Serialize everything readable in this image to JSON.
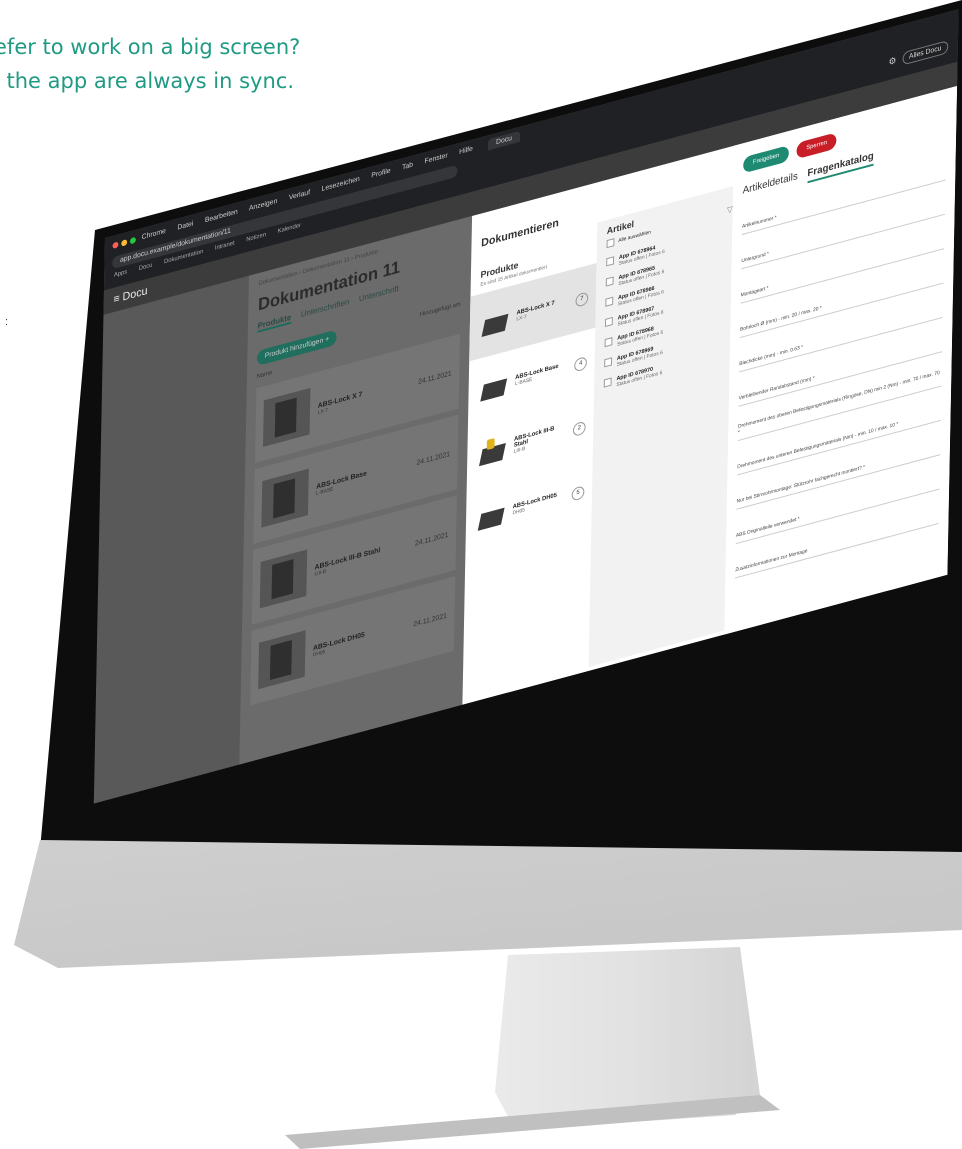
{
  "headline": {
    "line1": "efer to work on a big screen?",
    "line2": "l the app are always in sync."
  },
  "browser": {
    "menu": [
      "Chrome",
      "Datei",
      "Bearbeiten",
      "Anzeigen",
      "Verlauf",
      "Lesezeichen",
      "Profile",
      "Tab",
      "Fenster",
      "Hilfe"
    ],
    "tab_label": "Docu",
    "address": "app.docu.example/dokumentation/11",
    "bookmarks": [
      "Apps",
      "Docu",
      "Dokumentation",
      "Intranet",
      "Notizen",
      "Kalender"
    ],
    "alle_label": "Alles Docu"
  },
  "app": {
    "brand": "≡ Docu"
  },
  "left_page": {
    "breadcrumb": "Dokumentation  ›  Dokumentation 11  ›  Produkte",
    "title": "Dokumentation 11",
    "tabs": [
      "Produkte",
      "Unterschriften",
      "Unterschrift"
    ],
    "add_button": "Produkt hinzufügen +",
    "sort_label": "Hinzugefügt am",
    "section_label": "Name",
    "items": [
      {
        "name": "ABS-Lock X 7",
        "sub": "LX-7",
        "date": "24.11.2021"
      },
      {
        "name": "ABS-Lock Base",
        "sub": "L-BASE",
        "date": "24.11.2021"
      },
      {
        "name": "ABS-Lock III-B Stahl",
        "sub": "LIII-B",
        "date": "24.11.2021"
      },
      {
        "name": "ABS-Lock DH05",
        "sub": "DH05",
        "date": "24.11.2021"
      }
    ]
  },
  "dialog": {
    "title": "Dokumentieren",
    "products_heading": "Produkte",
    "products_sub": "Es sind 15 Artikel dokumentiert",
    "products": [
      {
        "name": "ABS-Lock X 7",
        "sub": "LX-7",
        "count": "7"
      },
      {
        "name": "ABS-Lock Base",
        "sub": "L-BASE",
        "count": "4"
      },
      {
        "name": "ABS-Lock III-B Stahl",
        "sub": "LIII-B",
        "count": "2"
      },
      {
        "name": "ABS-Lock DH05",
        "sub": "DH05",
        "count": "5"
      }
    ],
    "articles_heading": "Artikel",
    "select_all": "Alle auswählen",
    "articles": [
      {
        "id": "App ID 678964",
        "status": "Status offen",
        "fotos": "Fotos 6"
      },
      {
        "id": "App ID 678965",
        "status": "Status offen",
        "fotos": "Fotos 6"
      },
      {
        "id": "App ID 678966",
        "status": "Status offen",
        "fotos": "Fotos 6"
      },
      {
        "id": "App ID 678967",
        "status": "Status offen",
        "fotos": "Fotos 6"
      },
      {
        "id": "App ID 678968",
        "status": "Status offen",
        "fotos": "Fotos 6"
      },
      {
        "id": "App ID 678969",
        "status": "Status offen",
        "fotos": "Fotos 6"
      },
      {
        "id": "App ID 678970",
        "status": "Status offen",
        "fotos": "Fotos 6"
      }
    ],
    "release_button": "Freigeben",
    "lock_button": "Sperren",
    "form_tabs": [
      "Artikeldetails",
      "Fragenkatalog"
    ],
    "fields": [
      "Artikelnummer *",
      "Untergrund *",
      "Montageart *",
      "Bohrloch Ø (mm) - min. 20 / max. 20 *",
      "Blechdicke (mm) - min. 0.63 *",
      "Verbleibender Randabstand (mm) *",
      "Drehmoment des oberen Befestigungsmaterials (Ringöse, DN) min 2 (Nm) - min. 70 / max. 70 *",
      "Drehmoment des unteren Befestigungsmaterials (Nm) - min. 10 / max. 10 *",
      "Nur bei Stirnrohrmontage: Stützrohr fachgerecht montiert? *",
      "ABS Originalteile verwendet *",
      "Zusatzinformationen zur Montage"
    ]
  }
}
